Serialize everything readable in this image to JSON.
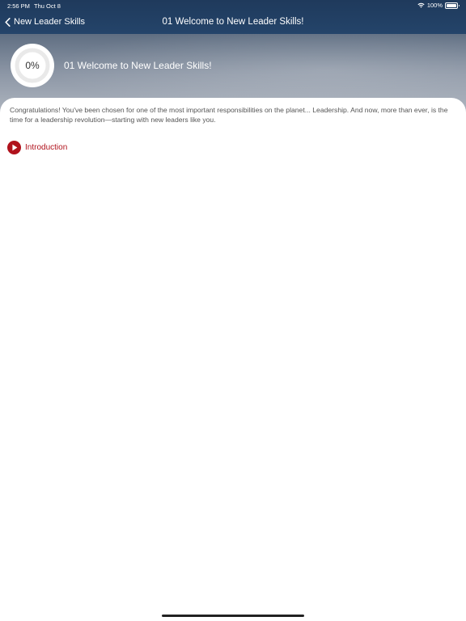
{
  "status_bar": {
    "time": "2:56 PM",
    "date": "Thu Oct 8",
    "battery": "100%"
  },
  "nav": {
    "back_label": "New Leader Skills",
    "title": "01 Welcome to New Leader Skills!"
  },
  "lesson": {
    "progress": "0%",
    "title": "01 Welcome to New Leader Skills!",
    "description": "Congratulations! You've been chosen for one of the most important responsibilities on the planet... Leadership. And now, more than ever, is the time for a leadership revolution—starting with new leaders like you."
  },
  "items": [
    {
      "label": "Introduction",
      "icon": "play-circle-icon"
    }
  ],
  "colors": {
    "nav_background": "#1f3a5c",
    "accent": "#b0121c"
  }
}
